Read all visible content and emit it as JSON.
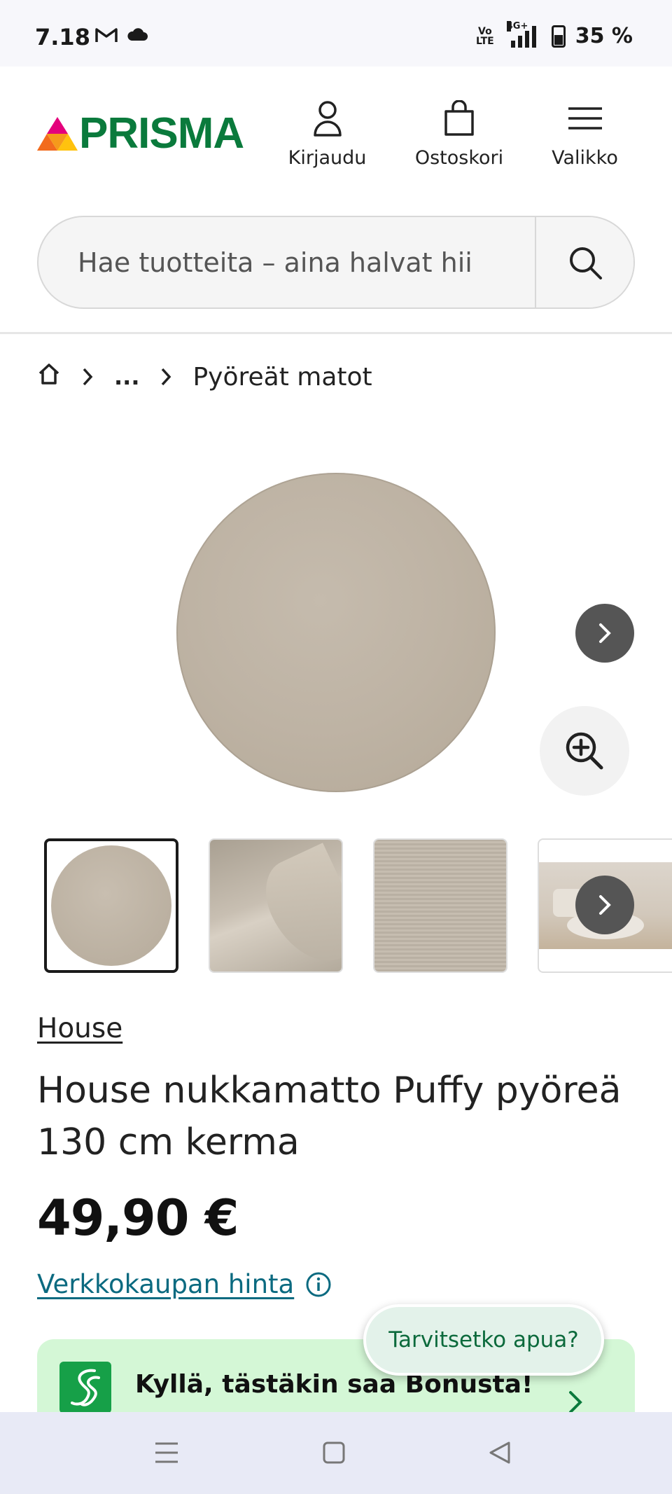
{
  "status_bar": {
    "time": "7.18",
    "volte_top": "Vo",
    "volte_bottom": "LTE",
    "network": "4G+",
    "battery": "35 %"
  },
  "header": {
    "logo_text": "PRISMA",
    "login_label": "Kirjaudu",
    "cart_label": "Ostoskori",
    "menu_label": "Valikko"
  },
  "search": {
    "placeholder": "Hae tuotteita – aina halvat hii"
  },
  "breadcrumb": {
    "ellipsis": "...",
    "current": "Pyöreät matot"
  },
  "product": {
    "brand": "House",
    "title": "House nukkamatto Puffy pyöreä 130 cm kerma",
    "price": "49,90 €",
    "online_price_label": "Verkkokaupan hinta"
  },
  "bonus_banner": {
    "text": "Kyllä, tästäkin saa Bonusta!"
  },
  "help_chip": {
    "label": "Tarvitsetko apua?"
  },
  "colors": {
    "brand_green": "#0a7a3c",
    "link_teal": "#0b6a80",
    "bonus_bg": "#d4f7d6",
    "rug_beige": "#beb3a4"
  }
}
